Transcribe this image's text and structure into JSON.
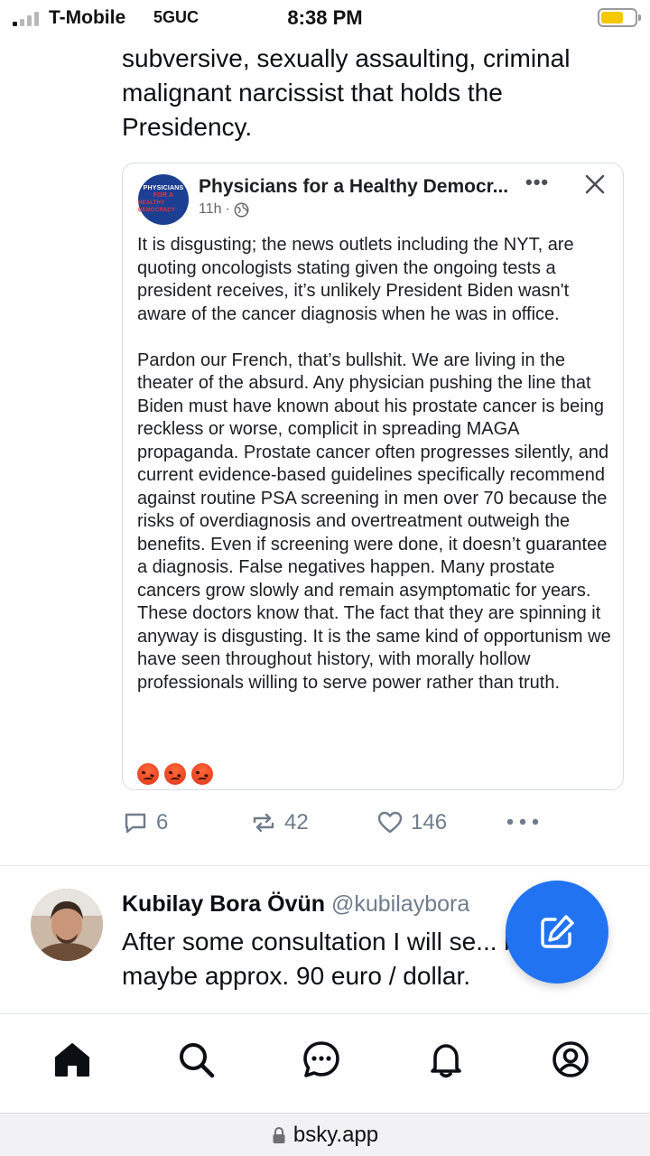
{
  "status_bar": {
    "carrier": "T-Mobile",
    "network": "5GUC",
    "time": "8:38 PM",
    "battery_level": 0.66
  },
  "post": {
    "text": "subversive, sexually assaulting, criminal malignant narcissist that holds the Presidency.",
    "embed": {
      "avatar_text": [
        "PHYSICIANS",
        "FOR A",
        "HEALTHY DEMOCRACY"
      ],
      "author": "Physicians for a Healthy Democr...",
      "time": "11h",
      "paragraphs": [
        "It is disgusting; the news outlets including the NYT, are quoting oncologists stating given the ongoing tests a president receives, it’s unlikely President Biden wasn't aware of the cancer diagnosis when he was in office.",
        "Pardon our French, that’s bullshit. We are living in the theater of the absurd. Any physician pushing the line that Biden must have known about his prostate cancer is being reckless or worse, complicit in spreading MAGA propaganda. Prostate cancer often progresses silently, and current evidence-based guidelines specifically recommend against routine PSA screening in men over 70 because the risks of overdiagnosis and overtreatment outweigh the benefits. Even if screening were done, it doesn’t guarantee a diagnosis. False negatives happen. Many prostate cancers grow slowly and remain asymptomatic for years. These doctors know that. The fact that they are spinning it anyway is disgusting. It is the same kind of opportunism we have seen throughout history, with morally hollow professionals willing to serve power rather than truth."
      ],
      "emoji_count": 3
    },
    "counts": {
      "replies": "6",
      "reposts": "42",
      "likes": "146"
    }
  },
  "next_post": {
    "display_name": "Kubilay Bora Övün",
    "handle": "@kubilaybora",
    "text": "After some consultation I will se... book at maybe approx. 90 euro / dollar."
  },
  "tabs": [
    "home",
    "search",
    "chat",
    "notifications",
    "profile"
  ],
  "url": "bsky.app",
  "colors": {
    "accent": "#2173f1",
    "muted": "#6f7c8b",
    "battery": "#f6c800"
  }
}
